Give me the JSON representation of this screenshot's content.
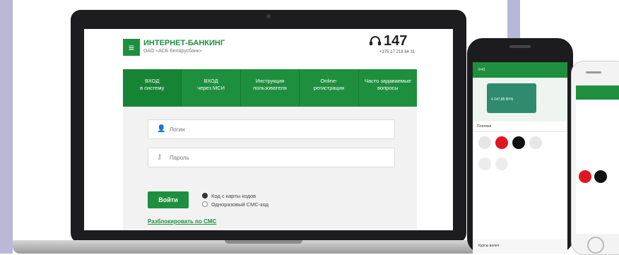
{
  "laptop": {
    "header": {
      "brand_title": "ИНТЕРНЕТ-БАНКИНГ",
      "brand_subtitle": "ОАО «АСБ Беларусбанк»",
      "phone_number": "147",
      "phone_sub": "+375 17 218 84 31"
    },
    "nav": [
      {
        "line1": "ВХОД",
        "line2": "в систему"
      },
      {
        "line1": "ВХОД",
        "line2": "через МСИ"
      },
      {
        "line1": "Инструкция",
        "line2": "пользователя"
      },
      {
        "line1": "Online-",
        "line2": "регистрация"
      },
      {
        "line1": "Часто задаваемые",
        "line2": "вопросы"
      }
    ],
    "login_form": {
      "login_placeholder": "Логин",
      "password_placeholder": "Пароль",
      "submit_label": "Войти",
      "option_card_code": "Код с карты кодов",
      "option_sms_code": "Одноразовый СМС-код",
      "unlock_link": "Разблокировать по СМС"
    }
  },
  "phone_app": {
    "status": "9:41",
    "card_amount": "4 247,85 BYN",
    "section_payments": "Платежи",
    "footer_text": "Курсы валют"
  },
  "colors": {
    "brand_green": "#1e8f3e",
    "frame": "#1d1d1f"
  },
  "icons": [
    "logo-icon",
    "headset-icon",
    "user-icon",
    "key-icon"
  ]
}
